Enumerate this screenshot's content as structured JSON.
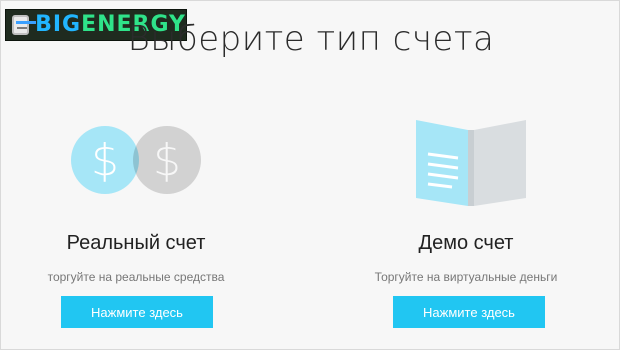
{
  "logo": {
    "text_part1": "BIG",
    "text_part2": "ENERGY"
  },
  "page_title": "Выберите тип счета",
  "cards": [
    {
      "title": "Реальный счет",
      "subtitle": "торгуйте на реальные средства",
      "button_label": "Нажмите здесь",
      "icon": "dollar-coins-icon",
      "coin_symbol": "$"
    },
    {
      "title": "Демо счет",
      "subtitle": "Торгуйте на виртуальные деньги",
      "button_label": "Нажмите здесь",
      "icon": "open-book-icon"
    }
  ],
  "colors": {
    "accent": "#21c6f2",
    "coin_blue": "#a6e6f7",
    "coin_gray": "#d9d9d9",
    "book_blue": "#a6e6f7",
    "book_gray": "#d9dde0"
  }
}
